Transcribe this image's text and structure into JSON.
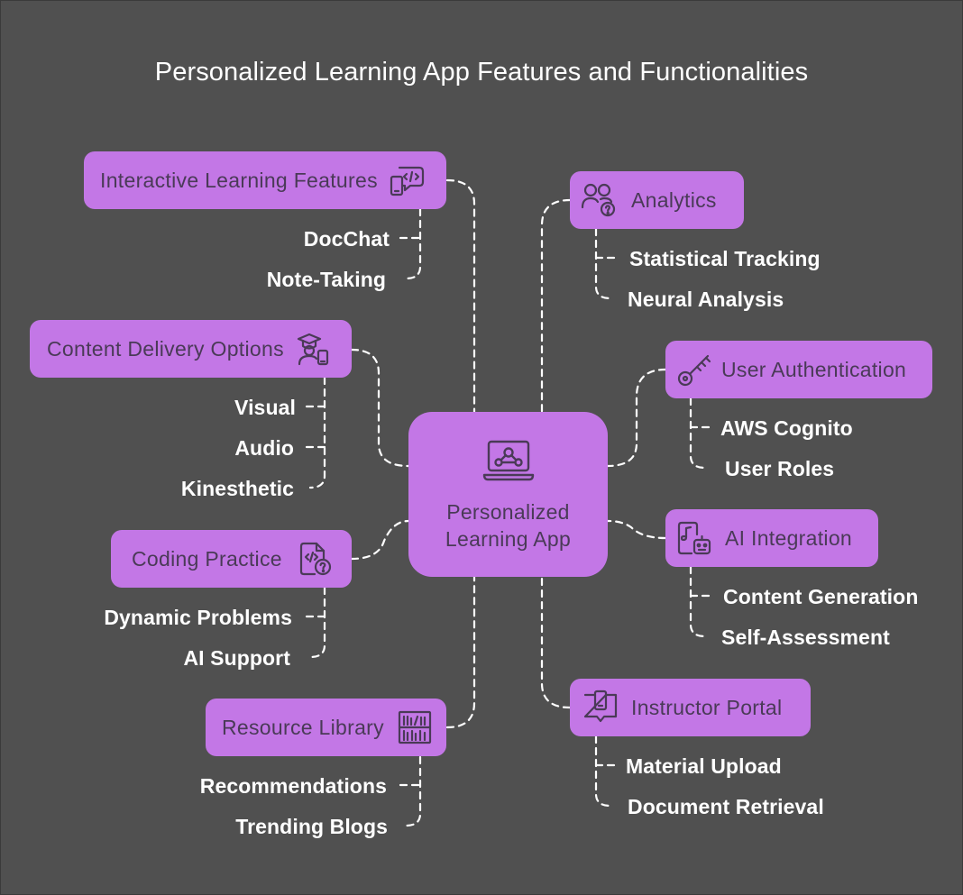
{
  "title": "Personalized Learning App Features and Functionalities",
  "center": {
    "label_line1": "Personalized",
    "label_line2": "Learning App",
    "icon": "laptop-network-icon"
  },
  "colors": {
    "background": "#505050",
    "node": "#c377e6",
    "node_text": "#4a3a57",
    "connector": "#ffffff"
  },
  "left": [
    {
      "label": "Interactive Learning Features",
      "icon": "code-chat-icon",
      "items": [
        "DocChat",
        "Note-Taking"
      ]
    },
    {
      "label": "Content Delivery Options",
      "icon": "student-device-icon",
      "items": [
        "Visual",
        "Audio",
        "Kinesthetic"
      ]
    },
    {
      "label": "Coding Practice",
      "icon": "code-question-icon",
      "items": [
        "Dynamic Problems",
        "AI Support"
      ]
    },
    {
      "label": "Resource Library",
      "icon": "bookshelf-icon",
      "items": [
        "Recommendations",
        "Trending Blogs"
      ]
    }
  ],
  "right": [
    {
      "label": "Analytics",
      "icon": "users-question-icon",
      "items": [
        "Statistical Tracking",
        "Neural Analysis"
      ]
    },
    {
      "label": "User Authentication",
      "icon": "key-icon",
      "items": [
        "AWS Cognito",
        "User Roles"
      ]
    },
    {
      "label": "AI Integration",
      "icon": "robot-music-icon",
      "items": [
        "Content Generation",
        "Self-Assessment"
      ]
    },
    {
      "label": "Instructor Portal",
      "icon": "book-upload-icon",
      "items": [
        "Material Upload",
        "Document Retrieval"
      ]
    }
  ]
}
